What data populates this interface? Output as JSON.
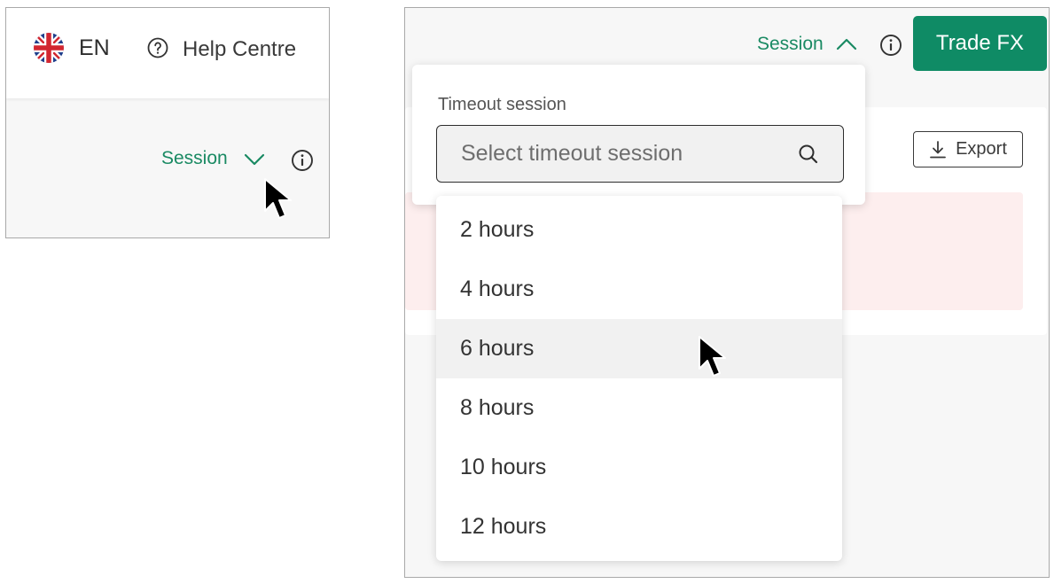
{
  "left": {
    "language": {
      "flag_icon": "uk-flag-icon",
      "code": "EN"
    },
    "help": {
      "icon": "question-circle-icon",
      "label": "Help Centre"
    },
    "session": {
      "label": "Session",
      "chevron": "chevron-down-icon"
    },
    "info_icon": "info-circle-icon"
  },
  "right": {
    "session": {
      "label": "Session",
      "chevron": "chevron-up-icon"
    },
    "info_icon": "info-circle-icon",
    "trade_button": "Trade FX",
    "export_button": {
      "icon": "download-icon",
      "label": "Export"
    },
    "dropdown": {
      "label": "Timeout session",
      "search_placeholder": "Select timeout session",
      "search_icon": "search-icon",
      "options": [
        "2 hours",
        "4 hours",
        "6 hours",
        "8 hours",
        "10 hours",
        "12 hours"
      ],
      "hovered_option": "6 hours"
    }
  },
  "colors": {
    "accent_green": "#0f8b65",
    "session_text": "#1a8a63",
    "alert_background": "#fdeeee",
    "hover_background": "#f1f1f1"
  }
}
